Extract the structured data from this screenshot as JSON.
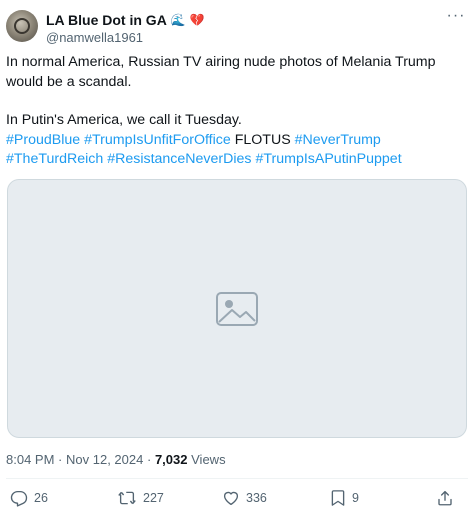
{
  "author": {
    "display_name": "LA Blue Dot in GA",
    "badges": [
      "wave-icon",
      "broken-heart-icon"
    ],
    "handle": "@namwella1961"
  },
  "tweet": {
    "line1": "In normal America, Russian TV airing nude photos of Melania Trump would be a scandal.",
    "line2": "In Putin's America, we call it Tuesday.",
    "hashtags": {
      "h1": "#ProudBlue",
      "h2": "#TrumpIsUnfitForOffice",
      "plain": "FLOTUS",
      "h3": "#NeverTrump",
      "h4": "#TheTurdReich",
      "h5": "#ResistanceNeverDies",
      "h6": "#TrumpIsAPutinPuppet"
    }
  },
  "meta": {
    "time": "8:04 PM",
    "separator": "·",
    "date": "Nov 12, 2024",
    "views_count": "7,032",
    "views_label": "Views"
  },
  "actions": {
    "replies": "26",
    "reposts": "227",
    "likes": "336",
    "bookmarks": "9"
  },
  "colors": {
    "link": "#1d9bf0",
    "text": "#0f1419",
    "secondary": "#536471",
    "heart": "#e0245e"
  }
}
